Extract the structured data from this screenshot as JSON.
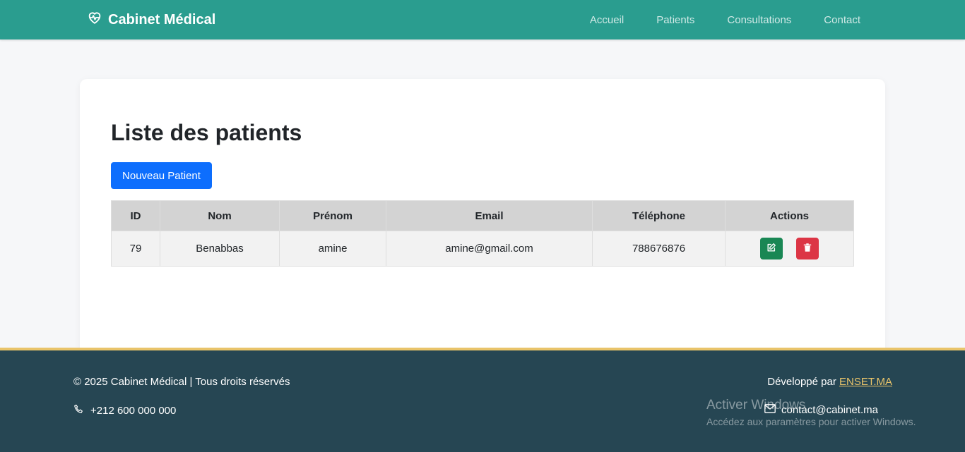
{
  "navbar": {
    "brand": "Cabinet Médical",
    "brand_icon": "heart-pulse-icon",
    "links": [
      "Accueil",
      "Patients",
      "Consultations",
      "Contact"
    ],
    "background_color": "#2a9d8f"
  },
  "main": {
    "title": "Liste des patients",
    "new_button_label": "Nouveau Patient",
    "table": {
      "headers": [
        "ID",
        "Nom",
        "Prénom",
        "Email",
        "Téléphone",
        "Actions"
      ],
      "rows": [
        {
          "id": "79",
          "nom": "Benabbas",
          "prenom": "amine",
          "email": "amine@gmail.com",
          "telephone": "788676876",
          "actions": [
            "edit-icon",
            "trash-icon"
          ]
        }
      ]
    }
  },
  "footer": {
    "copyright": "© 2025 Cabinet Médical | Tous droits réservés",
    "phone": "+212 600 000 000",
    "developed_by_prefix": "Développé par ",
    "developed_by_link": "ENSET.MA",
    "email": "contact@cabinet.ma",
    "background_color": "#264653",
    "accent_color": "#e9c46a"
  },
  "watermark": {
    "title": "Activer Windows",
    "subtitle": "Accédez aux paramètres pour activer Windows."
  }
}
